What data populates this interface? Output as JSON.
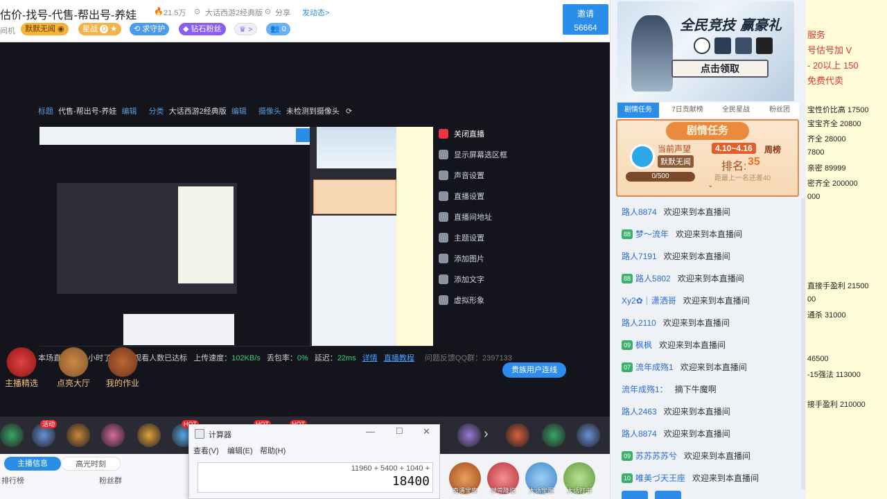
{
  "header": {
    "title": "估价-找号-代售-帮出号-养娃",
    "heat": "21.5万",
    "category": "大话西游2经典版",
    "share": "分享",
    "post": "发动态>",
    "id_prefix": "间机",
    "badges": {
      "fan": "默默无闻",
      "star": "星战",
      "star_count": "0",
      "guard": "求守护",
      "diamond": "钻石粉丝",
      "noble_more": ">",
      "fans_count": "0"
    },
    "invite_label": "邀请",
    "invite_count": "56664"
  },
  "stage": {
    "inner_title_label": "标题",
    "inner_title": "代售-帮出号-养娃",
    "edit": "编辑",
    "inner_cat_label": "分类",
    "inner_cat": "大话西游2经典版",
    "camera_label": "摄像头",
    "camera_value": "未检测到摄像头",
    "menu": [
      {
        "label": "关闭直播",
        "icon": "power-icon"
      },
      {
        "label": "显示屏幕选区框",
        "icon": "screen-icon"
      },
      {
        "label": "声音设置",
        "icon": "sound-icon"
      },
      {
        "label": "直播设置",
        "icon": "settings-icon"
      },
      {
        "label": "直播间地址",
        "icon": "location-icon"
      },
      {
        "label": "主题设置",
        "icon": "palette-icon"
      },
      {
        "label": "添加图片",
        "icon": "image-icon"
      },
      {
        "label": "添加文字",
        "icon": "text-icon"
      },
      {
        "label": "虚拟形象",
        "icon": "avatar-icon"
      }
    ],
    "status": {
      "notice": "本场直播时长1小时了，本场观看人数已达标",
      "upload_label": "上传速度：",
      "upload": "102KB/s",
      "loss_label": "丢包率：",
      "loss": "0%",
      "delay_label": "延迟：",
      "delay": "22ms",
      "detail": "详情",
      "tutorial": "直播教程",
      "feedback": "问题反馈QQ群：2397133"
    },
    "vip_link": "贵族用户连线",
    "anchor_tiles": [
      "主播精选",
      "点亮大厅",
      "我的作业"
    ]
  },
  "gift_bar": {
    "badges": [
      "活动",
      "HOT",
      "HOT",
      "HOT"
    ]
  },
  "bottom_tabs": {
    "tab1": "主播信息",
    "tab2": "高光时刻",
    "rank": "排行榜",
    "fans_group": "粉丝群"
  },
  "calculator": {
    "title": "计算器",
    "menu": [
      "查看(V)",
      "编辑(E)",
      "帮助(H)"
    ],
    "expression": "11960 + 5400 + 1040 +",
    "result": "18400"
  },
  "promo": [
    "奇遇宝库",
    "神兽降临",
    "大话宝图",
    "大话打书"
  ],
  "right_panel": {
    "banner_title": "全民竞技 赢豪礼",
    "banner_cta": "点击领取",
    "tabs": [
      "剧情任务",
      "7日贡献榜",
      "全民星战",
      "粉丝团"
    ],
    "task": {
      "title": "剧情任务",
      "prestige_label": "当前声望",
      "prestige": "默默无闻",
      "progress": "0/500",
      "period": "4.10~4.16",
      "week_rank": "周榜",
      "rank_label": "排名:",
      "rank": "35",
      "gap": "距最上一名还差40"
    },
    "chat": [
      {
        "lvl": "",
        "name": "路人8874",
        "msg": "欢迎来到本直播间"
      },
      {
        "lvl": "88",
        "name": "梦～流年",
        "msg": "欢迎来到本直播间"
      },
      {
        "lvl": "",
        "name": "路人7191",
        "msg": "欢迎来到本直播间"
      },
      {
        "lvl": "88",
        "name": "路人5802",
        "msg": "欢迎来到本直播间"
      },
      {
        "lvl": "",
        "name": "Xy2✿｜潇洒哥",
        "msg": "欢迎来到本直播间"
      },
      {
        "lvl": "",
        "name": "路人2110",
        "msg": "欢迎来到本直播间"
      },
      {
        "lvl": "09",
        "name": "枫枫",
        "msg": "欢迎来到本直播间"
      },
      {
        "lvl": "07",
        "name": "流年成殇1",
        "msg": "欢迎来到本直播间"
      },
      {
        "lvl": "",
        "name": "流年成殇1：",
        "msg": "摘下牛魔啊"
      },
      {
        "lvl": "",
        "name": "路人2463",
        "msg": "欢迎来到本直播间"
      },
      {
        "lvl": "",
        "name": "路人8874",
        "msg": "欢迎来到本直播间"
      },
      {
        "lvl": "09",
        "name": "苏苏苏苏兮",
        "msg": "欢迎来到本直播间"
      },
      {
        "lvl": "10",
        "name": "唯美づ天王座",
        "msg": "欢迎来到本直播间"
      }
    ]
  },
  "doc_panel": {
    "lines": [
      {
        "t": "服务",
        "c": "#d33"
      },
      {
        "t": "号估号加 V",
        "c": "#d33"
      },
      {
        "t": "- 20以上 150",
        "c": "#d33"
      },
      {
        "t": "免费代卖",
        "c": "#d33"
      },
      {
        "t": "宝性价比高 17500",
        "c": "#222"
      },
      {
        "t": "宝宝齐全 20800",
        "c": "#222"
      },
      {
        "t": "齐全 28000",
        "c": "#222"
      },
      {
        "t": "7800",
        "c": "#222"
      },
      {
        "t": "亲密 89999",
        "c": "#222"
      },
      {
        "t": "密齐全 200000",
        "c": "#222"
      },
      {
        "t": "000",
        "c": "#222"
      },
      {
        "t": "直接手盈利 21500",
        "c": "#222"
      },
      {
        "t": "00",
        "c": "#222"
      },
      {
        "t": "通杀 31000",
        "c": "#222"
      },
      {
        "t": "46500",
        "c": "#222"
      },
      {
        "t": "-15强法 113000",
        "c": "#222"
      },
      {
        "t": "接手盈利 210000",
        "c": "#222"
      }
    ]
  },
  "colors": {
    "accent": "#2a8ee8",
    "brand_orange": "#ff6a00",
    "chat_name": "#2b6cd8"
  }
}
